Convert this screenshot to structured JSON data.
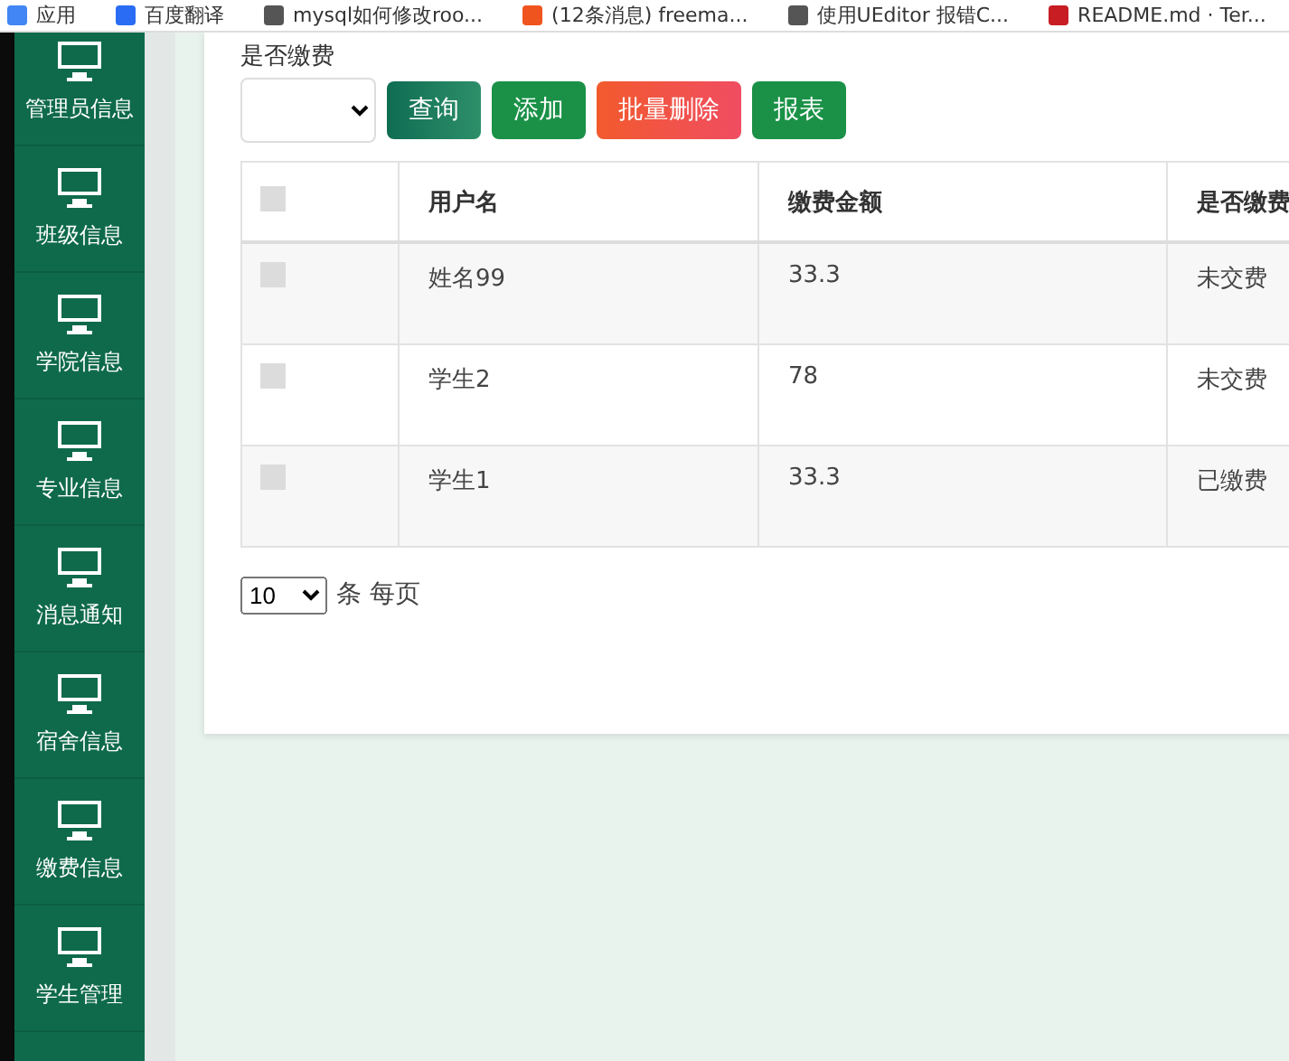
{
  "bookmarks": [
    {
      "label": "应用",
      "kind": "apps"
    },
    {
      "label": "百度翻译",
      "kind": "translate"
    },
    {
      "label": "mysql如何修改roo...",
      "kind": "search"
    },
    {
      "label": "(12条消息) freema...",
      "kind": "csdn"
    },
    {
      "label": "使用UEditor 报错C...",
      "kind": "search"
    },
    {
      "label": "README.md · Ter...",
      "kind": "gitee"
    }
  ],
  "sidebar": {
    "items": [
      "管理员信息",
      "班级信息",
      "学院信息",
      "专业信息",
      "消息通知",
      "宿舍信息",
      "缴费信息",
      "学生管理"
    ]
  },
  "filter": {
    "label": "是否缴费"
  },
  "buttons": [
    {
      "label": "查询",
      "kind": "teal"
    },
    {
      "label": "添加",
      "kind": "green"
    },
    {
      "label": "批量删除",
      "kind": "red"
    },
    {
      "label": "报表",
      "kind": "green"
    }
  ],
  "table": {
    "columns": [
      "用户名",
      "缴费金额",
      "是否缴费"
    ],
    "header_checked": false,
    "rows": [
      {
        "checked": false,
        "cells": [
          "姓名99",
          "33.3",
          "未交费"
        ]
      },
      {
        "checked": false,
        "cells": [
          "学生2",
          "78",
          "未交费"
        ]
      },
      {
        "checked": false,
        "cells": [
          "学生1",
          "33.3",
          "已缴费"
        ]
      }
    ]
  },
  "pagination": {
    "page_size": "10",
    "label": "条 每页"
  }
}
